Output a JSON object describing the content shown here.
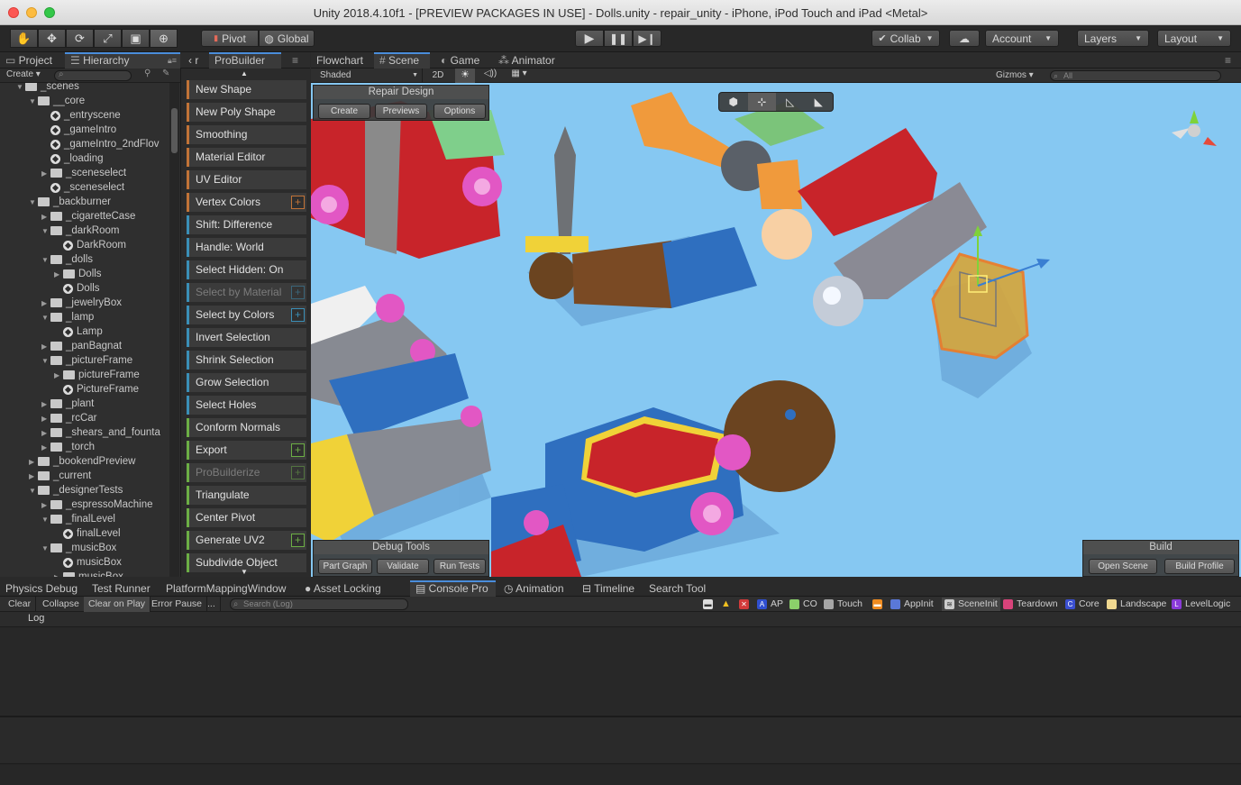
{
  "window": {
    "title": "Unity 2018.4.10f1 - [PREVIEW PACKAGES IN USE] - Dolls.unity - repair_unity - iPhone, iPod Touch and iPad <Metal>"
  },
  "toolbar": {
    "tools": [
      "hand-icon",
      "move-icon",
      "rotate-icon",
      "scale-icon",
      "rect-icon",
      "transform-icon"
    ],
    "pivot": "Pivot",
    "global": "Global",
    "collab": "Collab",
    "account": "Account",
    "layers": "Layers",
    "layout": "Layout"
  },
  "left_tabs": {
    "project": "Project",
    "hierarchy": "Hierarchy",
    "r": "r",
    "probuilder": "ProBuilder"
  },
  "hierarchy": {
    "create": "Create",
    "rows": [
      {
        "label": "_scenes",
        "type": "folder",
        "depth": 1,
        "open": true
      },
      {
        "label": "__core",
        "type": "folder",
        "depth": 2,
        "open": true
      },
      {
        "label": "_entryscene",
        "type": "scene",
        "depth": 3
      },
      {
        "label": "_gameIntro",
        "type": "scene",
        "depth": 3
      },
      {
        "label": "_gameIntro_2ndFlov",
        "type": "scene",
        "depth": 3
      },
      {
        "label": "_loading",
        "type": "scene",
        "depth": 3
      },
      {
        "label": "_sceneselect",
        "type": "folder",
        "depth": 3,
        "open": false
      },
      {
        "label": "_sceneselect",
        "type": "scene",
        "depth": 3
      },
      {
        "label": "_backburner",
        "type": "folder",
        "depth": 2,
        "open": true
      },
      {
        "label": "_cigaretteCase",
        "type": "folder",
        "depth": 3,
        "open": false
      },
      {
        "label": "_darkRoom",
        "type": "folder",
        "depth": 3,
        "open": true
      },
      {
        "label": "DarkRoom",
        "type": "scene",
        "depth": 4
      },
      {
        "label": "_dolls",
        "type": "folder",
        "depth": 3,
        "open": true
      },
      {
        "label": "Dolls",
        "type": "folder",
        "depth": 4,
        "open": false
      },
      {
        "label": "Dolls",
        "type": "scene",
        "depth": 4
      },
      {
        "label": "_jewelryBox",
        "type": "folder",
        "depth": 3,
        "open": false
      },
      {
        "label": "_lamp",
        "type": "folder",
        "depth": 3,
        "open": true
      },
      {
        "label": "Lamp",
        "type": "scene",
        "depth": 4
      },
      {
        "label": "_panBagnat",
        "type": "folder",
        "depth": 3,
        "open": false
      },
      {
        "label": "_pictureFrame",
        "type": "folder",
        "depth": 3,
        "open": true
      },
      {
        "label": "pictureFrame",
        "type": "folder",
        "depth": 4,
        "open": false
      },
      {
        "label": "PictureFrame",
        "type": "scene",
        "depth": 4
      },
      {
        "label": "_plant",
        "type": "folder",
        "depth": 3,
        "open": false
      },
      {
        "label": "_rcCar",
        "type": "folder",
        "depth": 3,
        "open": false
      },
      {
        "label": "_shears_and_founta",
        "type": "folder",
        "depth": 3,
        "open": false
      },
      {
        "label": "_torch",
        "type": "folder",
        "depth": 3,
        "open": false
      },
      {
        "label": "_bookendPreview",
        "type": "folder",
        "depth": 2,
        "open": false
      },
      {
        "label": "_current",
        "type": "folder",
        "depth": 2,
        "open": false
      },
      {
        "label": "_designerTests",
        "type": "folder",
        "depth": 2,
        "open": true
      },
      {
        "label": "_espressoMachine",
        "type": "folder",
        "depth": 3,
        "open": false
      },
      {
        "label": "_finalLevel",
        "type": "folder",
        "depth": 3,
        "open": true
      },
      {
        "label": "finalLevel",
        "type": "scene",
        "depth": 4
      },
      {
        "label": "_musicBox",
        "type": "folder",
        "depth": 3,
        "open": true
      },
      {
        "label": "musicBox",
        "type": "scene",
        "depth": 4
      },
      {
        "label": "musicBox",
        "type": "folder",
        "depth": 4,
        "open": false
      }
    ]
  },
  "probuilder": {
    "items": [
      {
        "label": "New Shape",
        "color": "#c17337",
        "disabled": false,
        "plus": false
      },
      {
        "label": "New Poly Shape",
        "color": "#c17337",
        "disabled": false,
        "plus": false
      },
      {
        "label": "Smoothing",
        "color": "#c17337",
        "disabled": false,
        "plus": false
      },
      {
        "label": "Material Editor",
        "color": "#c17337",
        "disabled": false,
        "plus": false
      },
      {
        "label": "UV Editor",
        "color": "#c17337",
        "disabled": false,
        "plus": false
      },
      {
        "label": "Vertex Colors",
        "color": "#c17337",
        "disabled": false,
        "plus": true
      },
      {
        "label": "Shift: Difference",
        "color": "#3a8fb7",
        "disabled": false,
        "plus": false
      },
      {
        "label": "Handle: World",
        "color": "#3a8fb7",
        "disabled": false,
        "plus": false
      },
      {
        "label": "Select Hidden: On",
        "color": "#3a8fb7",
        "disabled": false,
        "plus": false
      },
      {
        "label": "Select by Material",
        "color": "#3a8fb7",
        "disabled": true,
        "plus": true
      },
      {
        "label": "Select by Colors",
        "color": "#3a8fb7",
        "disabled": false,
        "plus": true
      },
      {
        "label": "Invert Selection",
        "color": "#3a8fb7",
        "disabled": false,
        "plus": false
      },
      {
        "label": "Shrink Selection",
        "color": "#3a8fb7",
        "disabled": false,
        "plus": false
      },
      {
        "label": "Grow Selection",
        "color": "#3a8fb7",
        "disabled": false,
        "plus": false
      },
      {
        "label": "Select Holes",
        "color": "#3a8fb7",
        "disabled": false,
        "plus": false
      },
      {
        "label": "Conform Normals",
        "color": "#6cae45",
        "disabled": false,
        "plus": false
      },
      {
        "label": "Export",
        "color": "#6cae45",
        "disabled": false,
        "plus": true
      },
      {
        "label": "ProBuilderize",
        "color": "#6cae45",
        "disabled": true,
        "plus": true
      },
      {
        "label": "Triangulate",
        "color": "#6cae45",
        "disabled": false,
        "plus": false
      },
      {
        "label": "Center Pivot",
        "color": "#6cae45",
        "disabled": false,
        "plus": false
      },
      {
        "label": "Generate UV2",
        "color": "#6cae45",
        "disabled": false,
        "plus": true
      },
      {
        "label": "Subdivide Object",
        "color": "#6cae45",
        "disabled": false,
        "plus": false
      }
    ]
  },
  "scene_tabs": {
    "flowchart": "Flowchart",
    "scene": "Scene",
    "game": "Game",
    "animator": "Animator"
  },
  "scene_bar": {
    "shading": "Shaded",
    "mode_2d": "2D",
    "gizmos": "Gizmos",
    "search_placeholder": "All"
  },
  "repair_design": {
    "title": "Repair Design",
    "create": "Create",
    "previews": "Previews",
    "options": "Options"
  },
  "debug_tools": {
    "title": "Debug Tools",
    "part_graph": "Part Graph",
    "validate": "Validate",
    "run_tests": "Run Tests"
  },
  "build_panel": {
    "title": "Build",
    "open_scene": "Open Scene",
    "build_profile": "Build Profile"
  },
  "bottom_tabs": [
    "Physics Debug",
    "Test Runner",
    "PlatformMappingWindow",
    "Asset Locking",
    "Console Pro",
    "Animation",
    "Timeline",
    "Search Tool"
  ],
  "console": {
    "clear": "Clear",
    "collapse": "Collapse",
    "clear_on_play": "Clear on Play",
    "error_pause": "Error Pause",
    "more": "...",
    "search_placeholder": "Search (Log)",
    "tags": [
      "AP",
      "CO",
      "Touch",
      "AppInit",
      "SceneInit",
      "Teardown",
      "Core",
      "Landscape",
      "LevelLogic"
    ],
    "column": "Log"
  },
  "colors": {
    "accent": "#4a8ddb",
    "sky": "#86c8f2",
    "orange": "#c17337",
    "blue": "#3a8fb7",
    "green": "#6cae45"
  }
}
